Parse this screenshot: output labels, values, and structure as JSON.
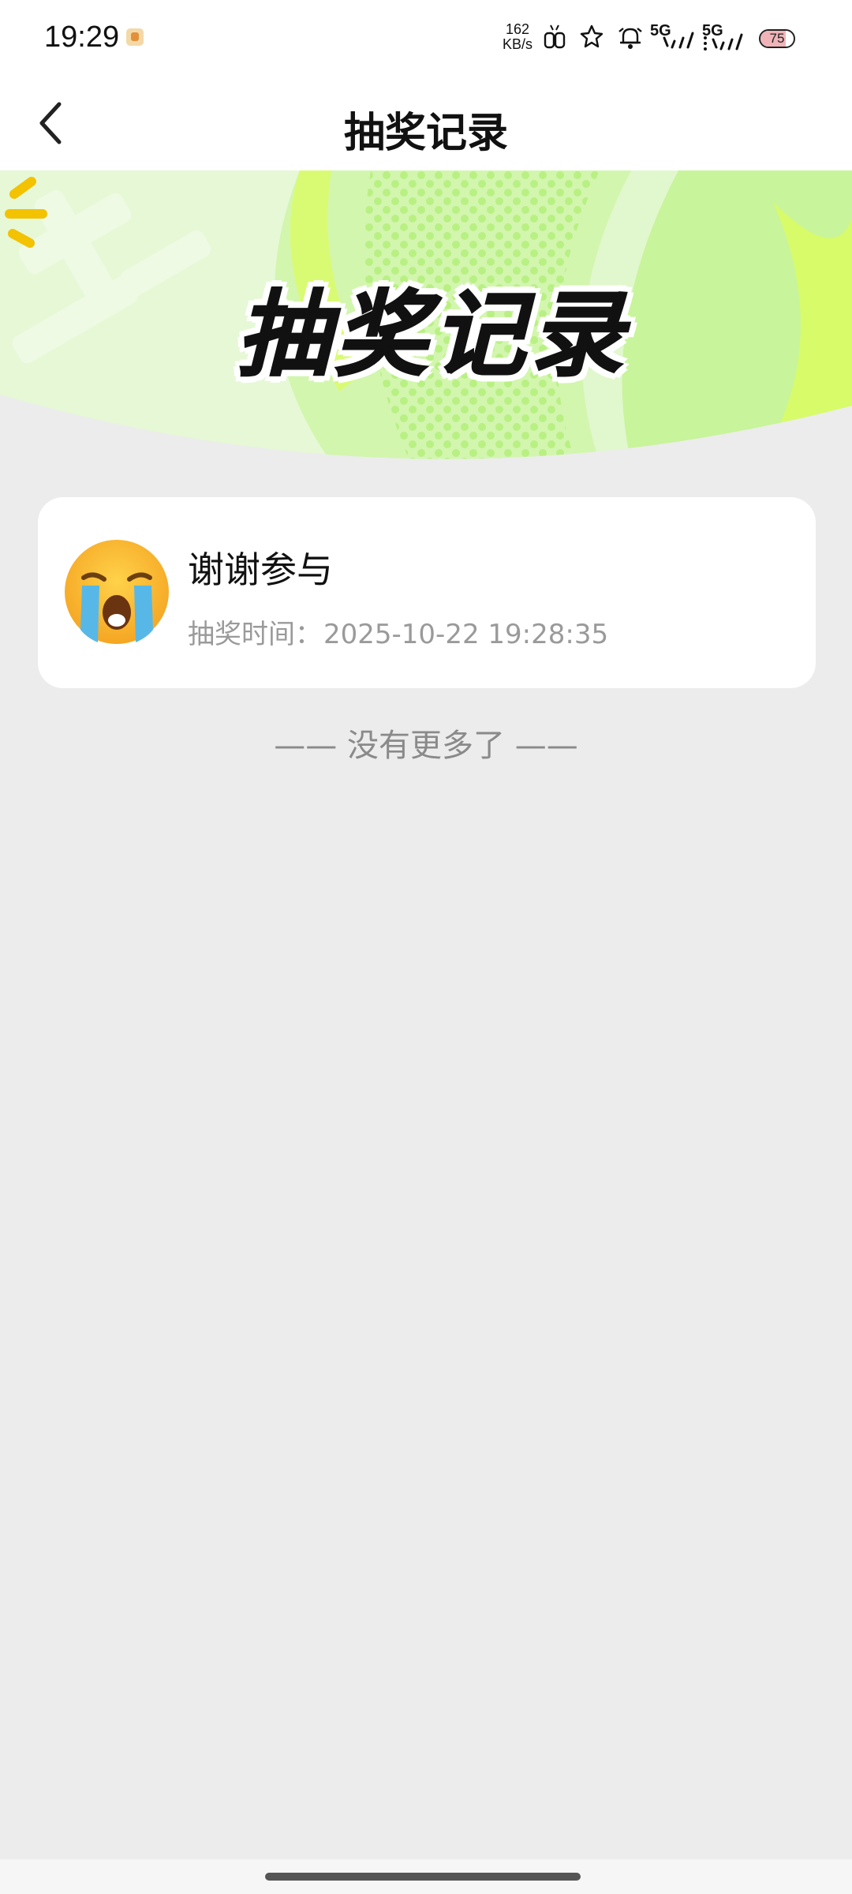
{
  "status_bar": {
    "time": "19:29",
    "net_speed_value": "162",
    "net_speed_unit": "KB/s",
    "signal_1": "5G",
    "signal_2": "5G",
    "battery": "75",
    "icons": [
      "app-notification-icon",
      "vibrate-icon",
      "star-icon",
      "alarm-icon",
      "signal-icon",
      "battery-icon"
    ]
  },
  "header": {
    "title": "抽奖记录",
    "back_icon": "chevron-left-icon"
  },
  "banner": {
    "title": "抽奖记录",
    "colors": {
      "light_green": "#dff7c8",
      "accent_green": "#c9f58e",
      "lime": "#d4fb6a"
    }
  },
  "records": [
    {
      "icon": "crying-face-emoji",
      "title": "谢谢参与",
      "time_label": "抽奖时间：",
      "time_value": "2025-10-22 19:28:35"
    }
  ],
  "footer": {
    "no_more": "—— 没有更多了 ——"
  },
  "colors": {
    "background": "#ececec",
    "card": "#ffffff",
    "muted_text": "#9a9a9a"
  }
}
